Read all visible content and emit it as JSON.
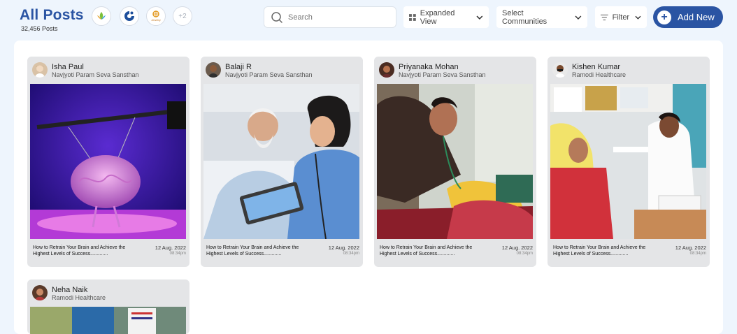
{
  "header": {
    "title": "All Posts",
    "count": "32,456 Posts",
    "communities": [
      {
        "name": "Lotus community logo",
        "icon": "lotus-icon"
      },
      {
        "name": "Swirl community logo",
        "icon": "swirl-icon"
      },
      {
        "name": "Jewelry community logo",
        "icon": "jewelry-icon",
        "logo_text": "Jewelry"
      },
      {
        "name": "more",
        "label": "+2"
      }
    ],
    "search_placeholder": "Search",
    "view_label": "Expanded View",
    "communities_label": "Select Communities",
    "filter_label": "Filter",
    "add_label": "Add New",
    "accent": "#2a54a3"
  },
  "posts": [
    {
      "author": "Isha Paul",
      "org": "Navjyoti Param Seva Sansthan",
      "caption": "How to Retrain Your Brain and Achieve the Highest Levels of Success.............",
      "date": "12 Aug. 2022",
      "time": "08:34pm",
      "image": "brain-lab-photo"
    },
    {
      "author": "Balaji R",
      "org": "Navjyoti Param Seva Sansthan",
      "caption": "How to Retrain Your Brain and Achieve the Highest Levels of Success.............",
      "date": "12 Aug. 2022",
      "time": "08:34pm",
      "image": "nurse-patient-tablet-photo"
    },
    {
      "author": "Priyanaka Mohan",
      "org": "Navjyoti Param Seva Sansthan",
      "caption": "How to Retrain Your Brain and Achieve the Highest Levels of Success.............",
      "date": "12 Aug. 2022",
      "time": "08:34pm",
      "image": "doctor-stethoscope-photo"
    },
    {
      "author": "Kishen Kumar",
      "org": "Ramodi Healthcare",
      "caption": "How to Retrain Your Brain and Achieve the Highest Levels of Success.............",
      "date": "12 Aug. 2022",
      "time": "08:34pm",
      "image": "clinic-checkup-photo"
    },
    {
      "author": "Neha Naik",
      "org": "Ramodi Healthcare",
      "image": "clinic-room-photo"
    }
  ]
}
